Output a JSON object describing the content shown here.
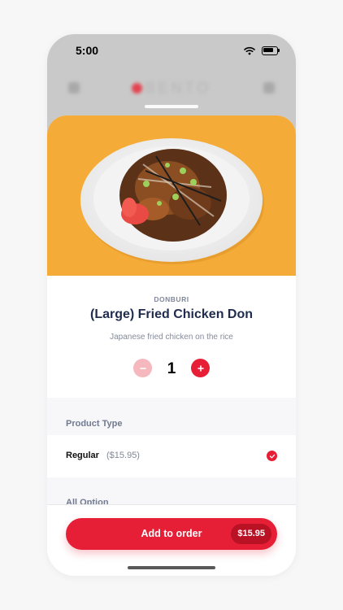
{
  "status_bar": {
    "time": "5:00"
  },
  "brand": {
    "name": "BENTO"
  },
  "product": {
    "category": "DONBURI",
    "title": "(Large) Fried Chicken Don",
    "description": "Japanese fried chicken on the rice",
    "quantity": "1"
  },
  "product_type": {
    "label": "Product Type",
    "options": [
      {
        "name": "Regular",
        "price": "($15.95)",
        "selected": true
      }
    ]
  },
  "all_option": {
    "label": "All Option"
  },
  "order": {
    "button_label": "Add to order",
    "price": "$15.95"
  },
  "icons": {
    "wifi": "wifi-icon",
    "battery": "battery-icon",
    "minus": "minus-icon",
    "plus": "plus-icon",
    "check": "check-icon"
  },
  "colors": {
    "accent": "#e71f36",
    "hero_background": "#f5ab37",
    "title": "#1f2c4d"
  }
}
